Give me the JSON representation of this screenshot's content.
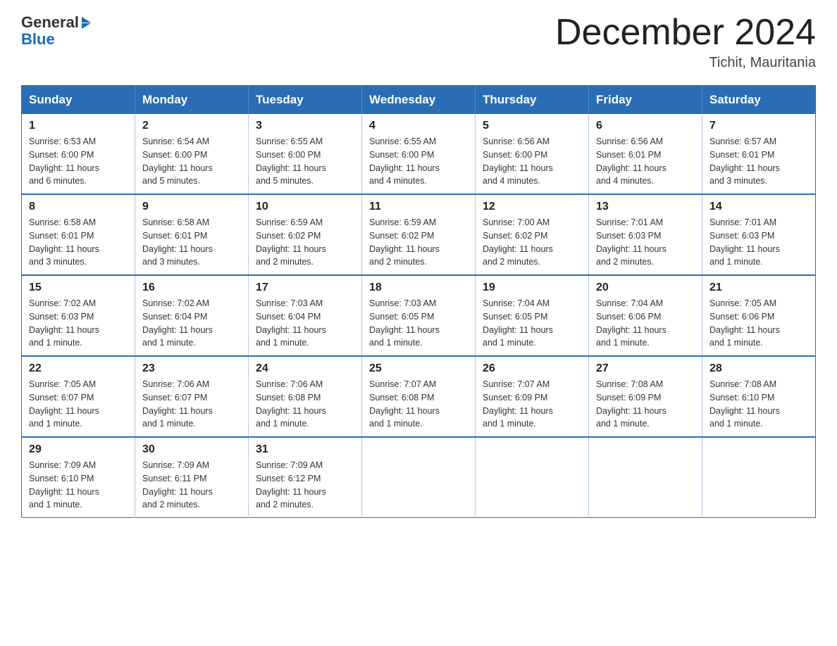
{
  "header": {
    "logo_general": "General",
    "logo_blue": "Blue",
    "month_title": "December 2024",
    "subtitle": "Tichit, Mauritania"
  },
  "weekdays": [
    "Sunday",
    "Monday",
    "Tuesday",
    "Wednesday",
    "Thursday",
    "Friday",
    "Saturday"
  ],
  "weeks": [
    [
      {
        "day": "1",
        "sunrise": "6:53 AM",
        "sunset": "6:00 PM",
        "daylight": "11 hours and 6 minutes."
      },
      {
        "day": "2",
        "sunrise": "6:54 AM",
        "sunset": "6:00 PM",
        "daylight": "11 hours and 5 minutes."
      },
      {
        "day": "3",
        "sunrise": "6:55 AM",
        "sunset": "6:00 PM",
        "daylight": "11 hours and 5 minutes."
      },
      {
        "day": "4",
        "sunrise": "6:55 AM",
        "sunset": "6:00 PM",
        "daylight": "11 hours and 4 minutes."
      },
      {
        "day": "5",
        "sunrise": "6:56 AM",
        "sunset": "6:00 PM",
        "daylight": "11 hours and 4 minutes."
      },
      {
        "day": "6",
        "sunrise": "6:56 AM",
        "sunset": "6:01 PM",
        "daylight": "11 hours and 4 minutes."
      },
      {
        "day": "7",
        "sunrise": "6:57 AM",
        "sunset": "6:01 PM",
        "daylight": "11 hours and 3 minutes."
      }
    ],
    [
      {
        "day": "8",
        "sunrise": "6:58 AM",
        "sunset": "6:01 PM",
        "daylight": "11 hours and 3 minutes."
      },
      {
        "day": "9",
        "sunrise": "6:58 AM",
        "sunset": "6:01 PM",
        "daylight": "11 hours and 3 minutes."
      },
      {
        "day": "10",
        "sunrise": "6:59 AM",
        "sunset": "6:02 PM",
        "daylight": "11 hours and 2 minutes."
      },
      {
        "day": "11",
        "sunrise": "6:59 AM",
        "sunset": "6:02 PM",
        "daylight": "11 hours and 2 minutes."
      },
      {
        "day": "12",
        "sunrise": "7:00 AM",
        "sunset": "6:02 PM",
        "daylight": "11 hours and 2 minutes."
      },
      {
        "day": "13",
        "sunrise": "7:01 AM",
        "sunset": "6:03 PM",
        "daylight": "11 hours and 2 minutes."
      },
      {
        "day": "14",
        "sunrise": "7:01 AM",
        "sunset": "6:03 PM",
        "daylight": "11 hours and 1 minute."
      }
    ],
    [
      {
        "day": "15",
        "sunrise": "7:02 AM",
        "sunset": "6:03 PM",
        "daylight": "11 hours and 1 minute."
      },
      {
        "day": "16",
        "sunrise": "7:02 AM",
        "sunset": "6:04 PM",
        "daylight": "11 hours and 1 minute."
      },
      {
        "day": "17",
        "sunrise": "7:03 AM",
        "sunset": "6:04 PM",
        "daylight": "11 hours and 1 minute."
      },
      {
        "day": "18",
        "sunrise": "7:03 AM",
        "sunset": "6:05 PM",
        "daylight": "11 hours and 1 minute."
      },
      {
        "day": "19",
        "sunrise": "7:04 AM",
        "sunset": "6:05 PM",
        "daylight": "11 hours and 1 minute."
      },
      {
        "day": "20",
        "sunrise": "7:04 AM",
        "sunset": "6:06 PM",
        "daylight": "11 hours and 1 minute."
      },
      {
        "day": "21",
        "sunrise": "7:05 AM",
        "sunset": "6:06 PM",
        "daylight": "11 hours and 1 minute."
      }
    ],
    [
      {
        "day": "22",
        "sunrise": "7:05 AM",
        "sunset": "6:07 PM",
        "daylight": "11 hours and 1 minute."
      },
      {
        "day": "23",
        "sunrise": "7:06 AM",
        "sunset": "6:07 PM",
        "daylight": "11 hours and 1 minute."
      },
      {
        "day": "24",
        "sunrise": "7:06 AM",
        "sunset": "6:08 PM",
        "daylight": "11 hours and 1 minute."
      },
      {
        "day": "25",
        "sunrise": "7:07 AM",
        "sunset": "6:08 PM",
        "daylight": "11 hours and 1 minute."
      },
      {
        "day": "26",
        "sunrise": "7:07 AM",
        "sunset": "6:09 PM",
        "daylight": "11 hours and 1 minute."
      },
      {
        "day": "27",
        "sunrise": "7:08 AM",
        "sunset": "6:09 PM",
        "daylight": "11 hours and 1 minute."
      },
      {
        "day": "28",
        "sunrise": "7:08 AM",
        "sunset": "6:10 PM",
        "daylight": "11 hours and 1 minute."
      }
    ],
    [
      {
        "day": "29",
        "sunrise": "7:09 AM",
        "sunset": "6:10 PM",
        "daylight": "11 hours and 1 minute."
      },
      {
        "day": "30",
        "sunrise": "7:09 AM",
        "sunset": "6:11 PM",
        "daylight": "11 hours and 2 minutes."
      },
      {
        "day": "31",
        "sunrise": "7:09 AM",
        "sunset": "6:12 PM",
        "daylight": "11 hours and 2 minutes."
      },
      null,
      null,
      null,
      null
    ]
  ],
  "labels": {
    "sunrise": "Sunrise:",
    "sunset": "Sunset:",
    "daylight": "Daylight:"
  }
}
